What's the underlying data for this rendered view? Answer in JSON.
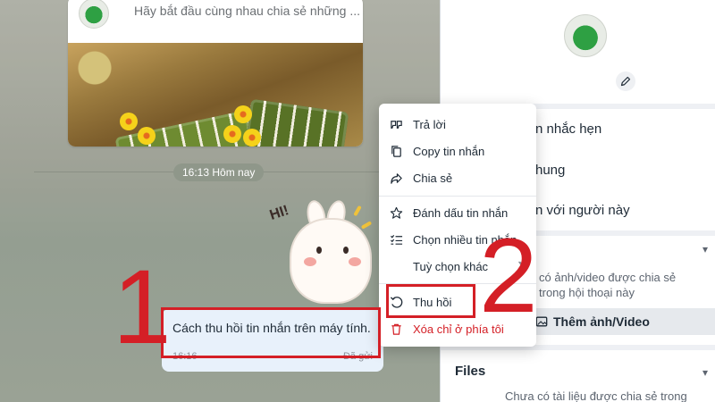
{
  "chat": {
    "shared_card_snippet": "Hãy bắt đầu cùng nhau chia sẻ những ...",
    "time_divider": "16:13 Hôm nay",
    "sticker_text": "HI!",
    "message": {
      "text": "Cách thu hồi tin nhắn trên máy tính.",
      "time": "16:16",
      "status": "Đã gửi"
    }
  },
  "annotations": {
    "step1": "1",
    "step2": "2",
    "color": "#d41f26"
  },
  "context_menu": {
    "items": [
      {
        "label": "Trả lời",
        "icon": "quote-icon"
      },
      {
        "label": "Copy tin nhắn",
        "icon": "copy-icon"
      },
      {
        "label": "Chia sẻ",
        "icon": "share-icon"
      },
      {
        "label": "Đánh dấu tin nhắn",
        "icon": "star-icon"
      },
      {
        "label": "Chọn nhiều tin nhắn",
        "icon": "checklist-icon"
      },
      {
        "label": "Tuỳ chọn khác",
        "icon": "none"
      },
      {
        "label": "Thu hồi",
        "icon": "undo-icon"
      },
      {
        "label": "Xóa chỉ ở phía tôi",
        "icon": "trash-icon"
      }
    ]
  },
  "right_panel": {
    "row_reminder": "n nhắc hẹn",
    "row_groups": "hung",
    "row_with_person": "n với người này",
    "media_empty": "có ảnh/video được chia sẻ trong hội thoại này",
    "add_media_button": "Thêm ảnh/Video",
    "files_title": "Files",
    "files_empty": "Chưa có tài liệu được chia sẻ trong"
  }
}
